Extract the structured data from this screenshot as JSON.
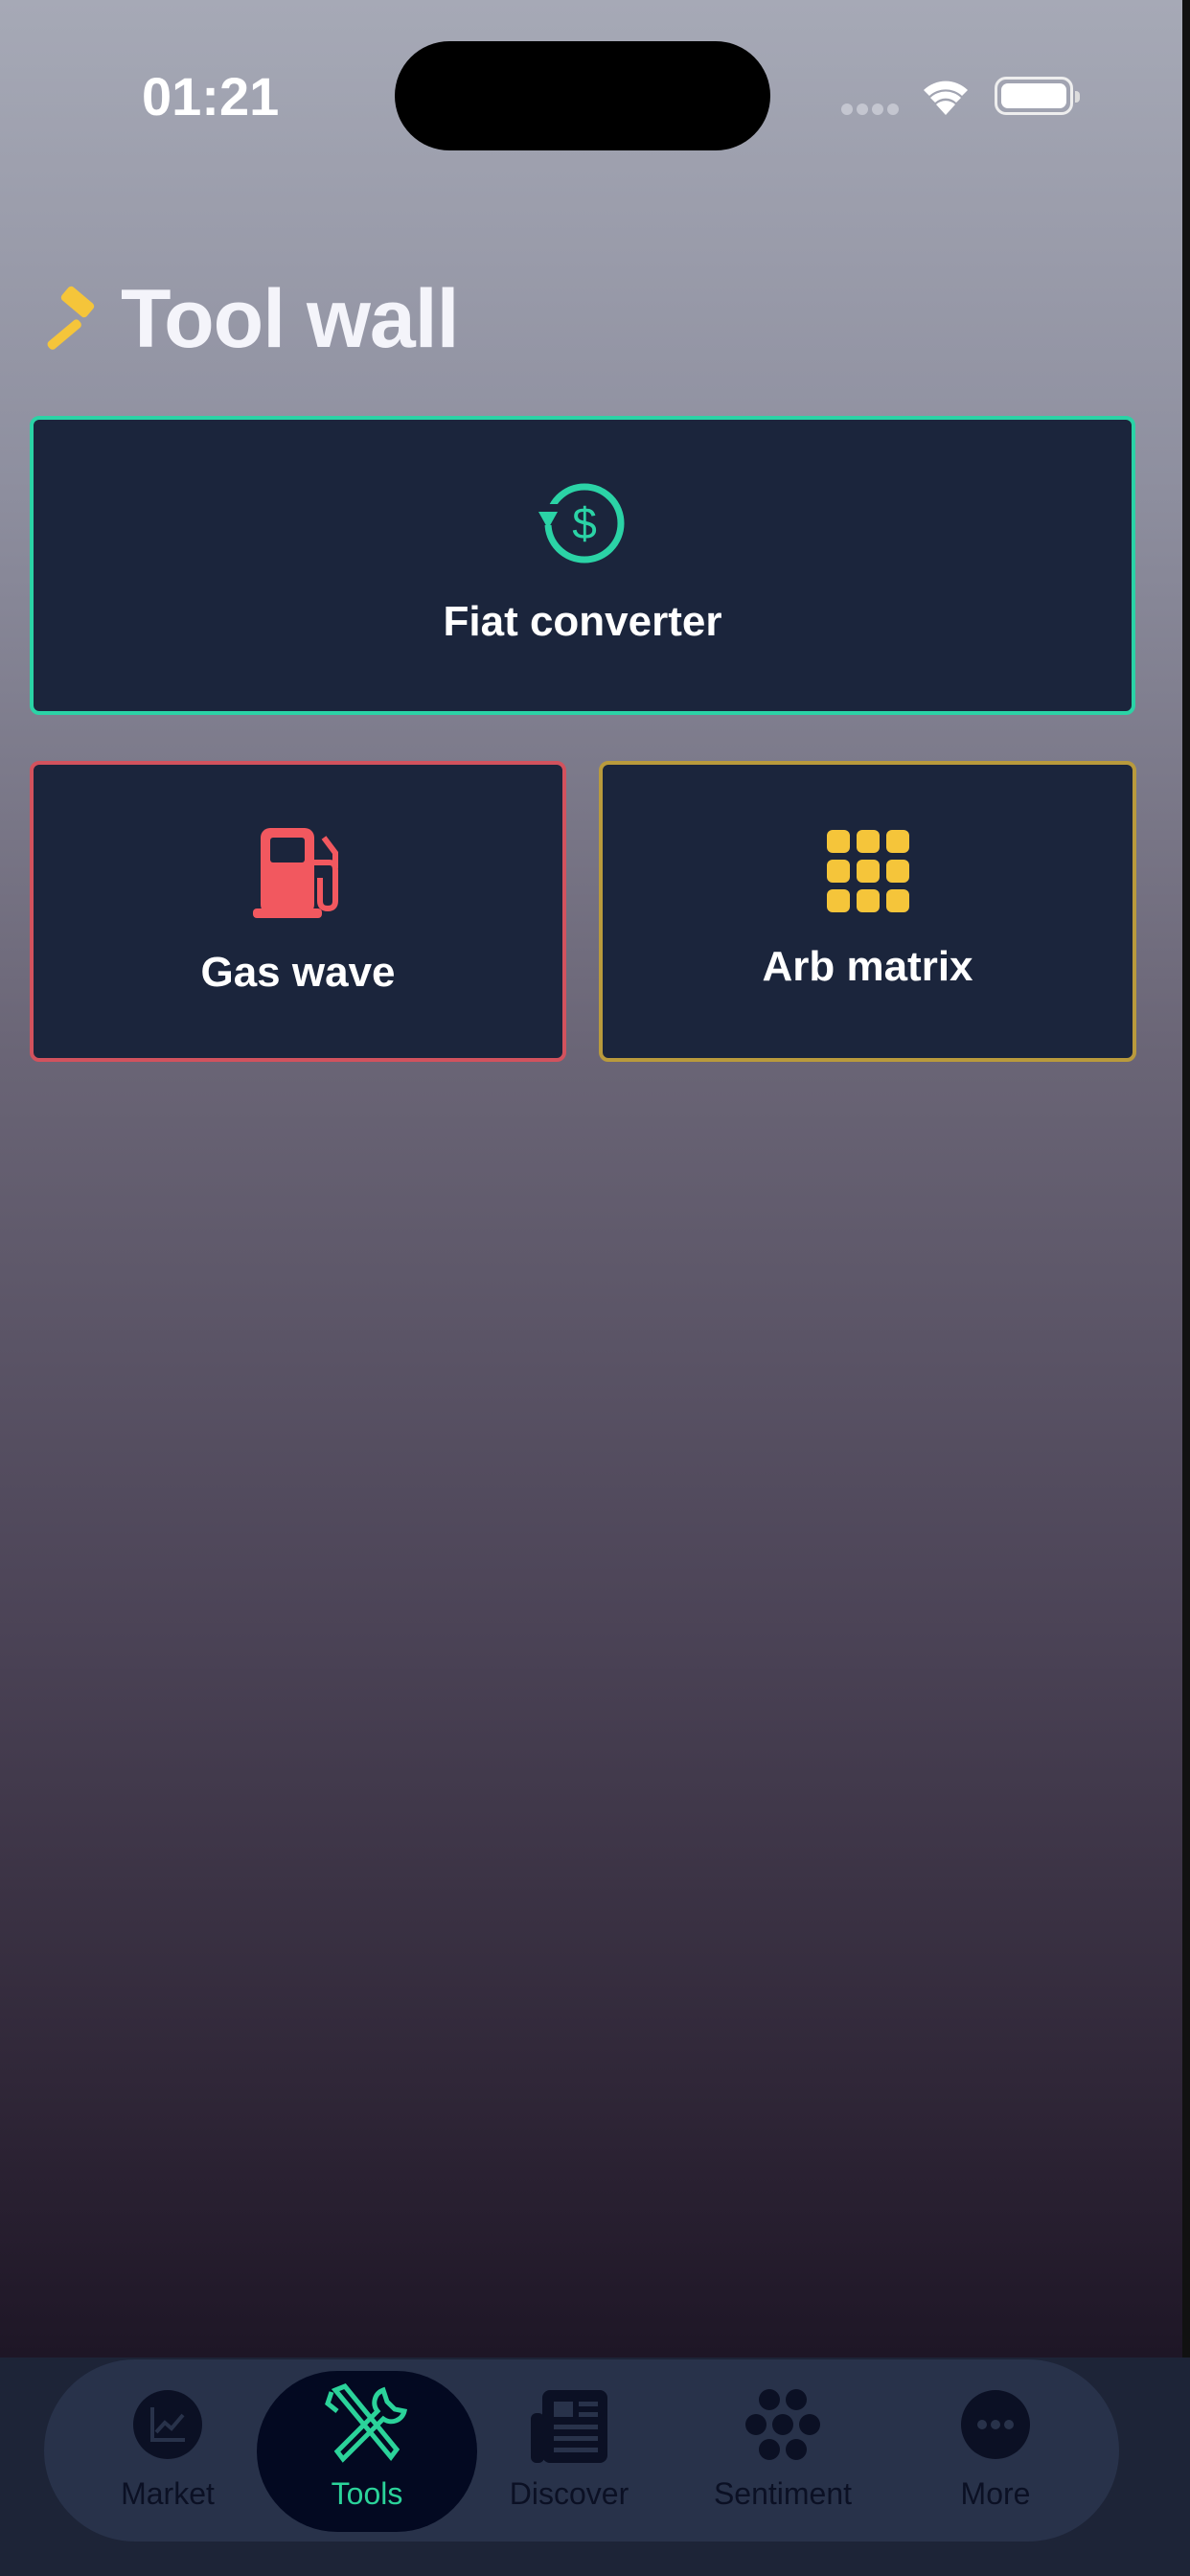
{
  "status_bar": {
    "time": "01:21"
  },
  "header": {
    "title": "Tool wall",
    "icon": "hammer-icon"
  },
  "tools": [
    {
      "label": "Fiat converter",
      "icon": "currency-exchange-icon",
      "color": "#2bd3a6"
    },
    {
      "label": "Gas wave",
      "icon": "fuel-pump-icon",
      "color": "#f2585f"
    },
    {
      "label": "Arb matrix",
      "icon": "grid-icon",
      "color": "#f5c53a"
    }
  ],
  "tab_bar": {
    "active_color": "#2bd39a",
    "items": [
      {
        "label": "Market",
        "icon": "chart-icon"
      },
      {
        "label": "Tools",
        "icon": "tools-icon",
        "active": true
      },
      {
        "label": "Discover",
        "icon": "newspaper-icon"
      },
      {
        "label": "Sentiment",
        "icon": "flower-icon"
      },
      {
        "label": "More",
        "icon": "more-icon"
      }
    ]
  }
}
